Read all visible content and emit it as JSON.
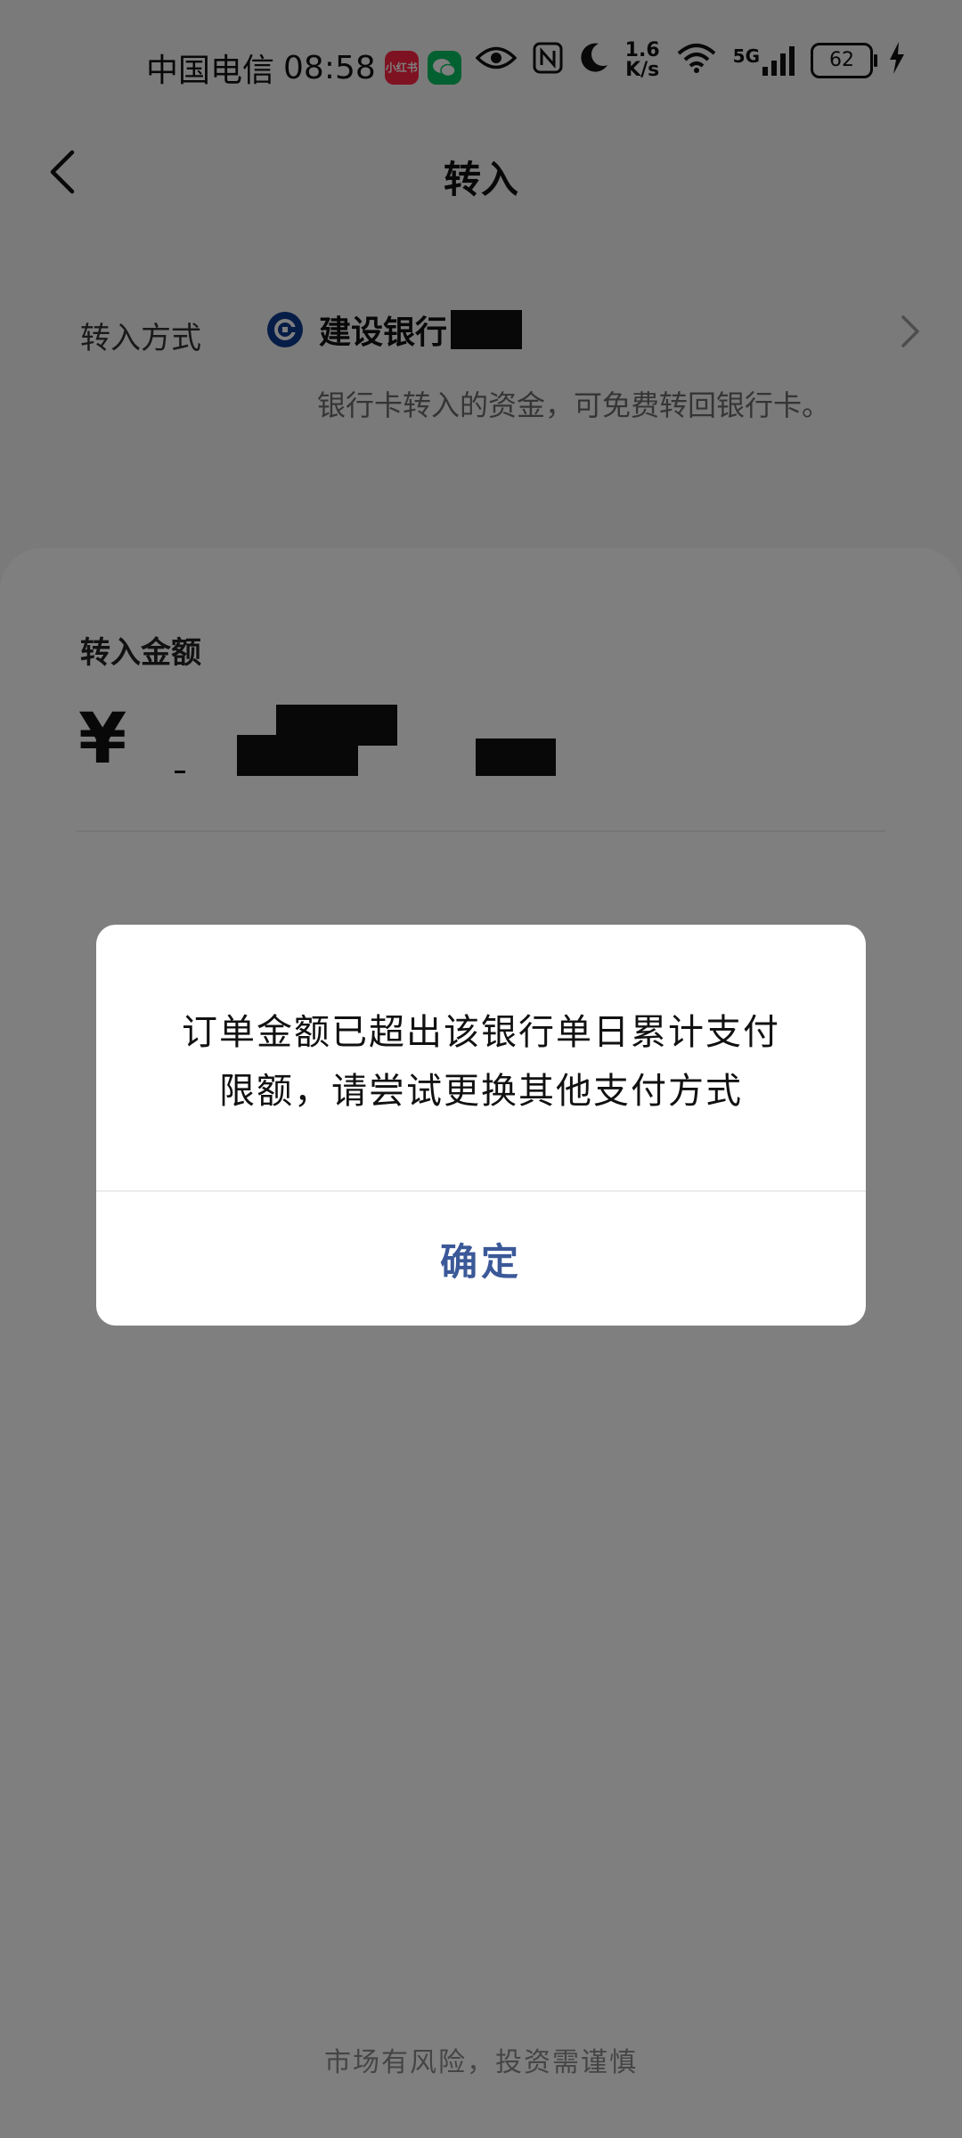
{
  "status_bar": {
    "carrier": "中国电信",
    "time": "08:58",
    "app_icons": [
      "xiaohongshu-icon",
      "wechat-icon"
    ],
    "xhs_badge_text": "小红书",
    "net_speed_value": "1.6",
    "net_speed_unit": "K/s",
    "network": "5G",
    "battery": "62",
    "icons": [
      "eye-icon",
      "nfc-icon",
      "moon-icon",
      "wifi-icon",
      "signal-icon",
      "battery-icon",
      "charging-icon"
    ]
  },
  "header": {
    "title": "转入",
    "back_icon": "chevron-left-icon"
  },
  "transfer_method": {
    "label": "转入方式",
    "bank_name": "建设银行",
    "bank_icon": "ccb-bank-logo",
    "note": "银行卡转入的资金，可免费转回银行卡。",
    "chevron_icon": "chevron-right-icon"
  },
  "amount": {
    "label": "转入金额",
    "currency": "¥"
  },
  "dialog": {
    "message": "订单金额已超出该银行单日累计支付限额，请尝试更换其他支付方式",
    "confirm_label": "确定"
  },
  "footer": {
    "note": "市场有风险，投资需谨慎"
  },
  "colors": {
    "background": "#f5f5f5",
    "card": "#ffffff",
    "overlay": "rgba(0,0,0,0.5)",
    "confirm_text": "#3b5998",
    "bank_blue": "#0d3b8e"
  }
}
